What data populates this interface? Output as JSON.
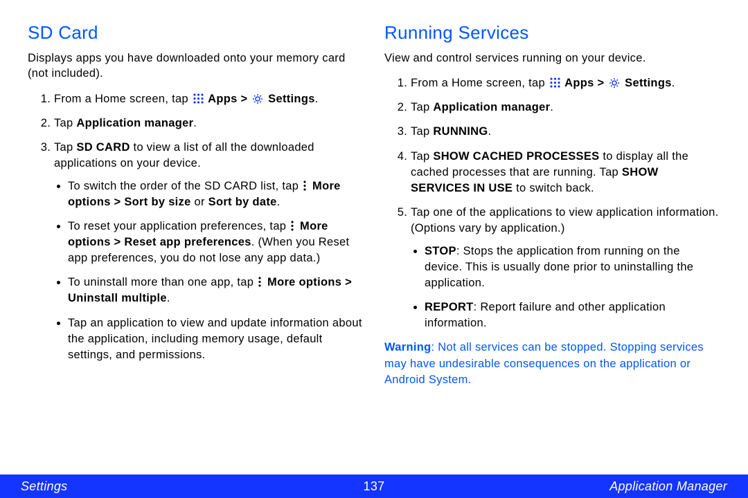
{
  "left": {
    "heading": "SD Card",
    "intro": "Displays apps you have downloaded onto your memory card (not included).",
    "step1a": "From a Home screen, tap ",
    "step1b": " Apps > ",
    "step1c": " Settings",
    "step1d": ".",
    "step2a": "Tap ",
    "step2b": "Application manager",
    "step2c": ".",
    "step3a": "Tap ",
    "step3b": "SD CARD",
    "step3c": " to view a list of all the downloaded applications on your device.",
    "b1a": "To switch the order of the SD CARD list, tap ",
    "b1b": " More options > Sort by size",
    "b1c": " or ",
    "b1d": "Sort by date",
    "b1e": ".",
    "b2a": "To reset your application preferences, tap ",
    "b2b": " More options > Reset app preferences",
    "b2c": ". (When you Reset app preferences, you do not lose any app data.)",
    "b3a": "To uninstall more than one app, tap ",
    "b3b": " More options > Uninstall multiple",
    "b3c": ".",
    "b4": "Tap an application to view and update information about the application, including memory usage, default settings, and permissions."
  },
  "right": {
    "heading": "Running Services",
    "intro": "View and control services running on your device.",
    "step1a": "From a Home screen, tap ",
    "step1b": " Apps > ",
    "step1c": " Settings",
    "step1d": ".",
    "step2a": "Tap ",
    "step2b": "Application manager",
    "step2c": ".",
    "step3a": "Tap ",
    "step3b": "RUNNING",
    "step3c": ".",
    "step4a": "Tap ",
    "step4b": "SHOW CACHED PROCESSES",
    "step4c": " to display all the cached processes that are running. Tap ",
    "step4d": "SHOW SERVICES IN USE",
    "step4e": " to switch back.",
    "step5": "Tap one of the applications to view application information. (Options vary by application.)",
    "b1a": "STOP",
    "b1b": ": Stops the application from running on the device. This is usually done prior to uninstalling the application.",
    "b2a": "REPORT",
    "b2b": ": Report failure and other application information.",
    "warn_label": "Warning",
    "warn_body": ": Not all services can be stopped. Stopping services may have undesirable consequences on the application or Android System."
  },
  "footer": {
    "left": "Settings",
    "center": "137",
    "right": "Application Manager"
  }
}
